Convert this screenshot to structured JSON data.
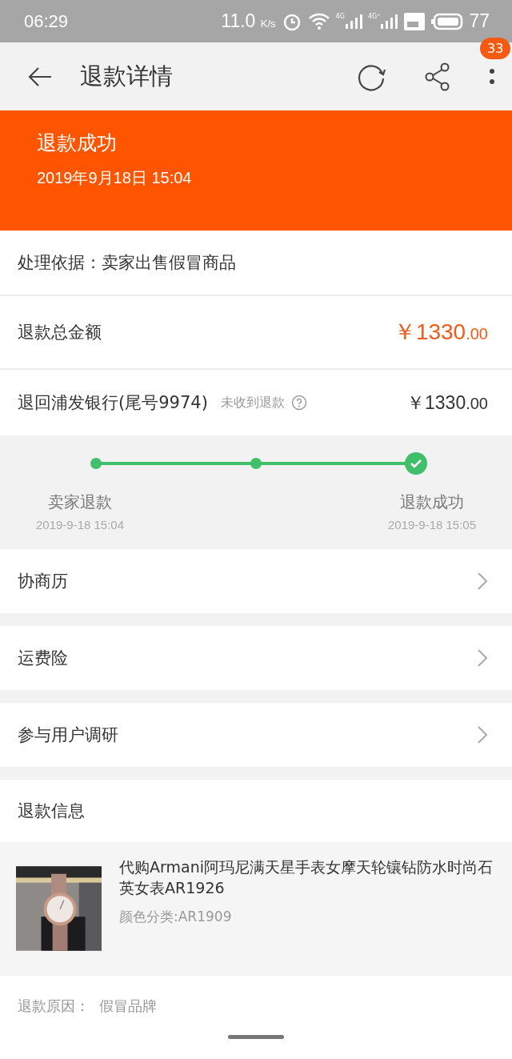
{
  "status_bar": {
    "time": "06:29",
    "speed": "11.0",
    "speed_unit": "K/s",
    "network_1": "4G",
    "network_2": "4G⁺",
    "battery": "77"
  },
  "header": {
    "title": "退款详情",
    "badge": "33"
  },
  "banner": {
    "status": "退款成功",
    "time": "2019年9月18日 15:04"
  },
  "basis": {
    "label": "处理依据：",
    "value": "卖家出售假冒商品"
  },
  "total": {
    "label": "退款总金额",
    "amount": "￥1330",
    "decimals": ".00"
  },
  "bank": {
    "label": "退回浦发银行(尾号9974)",
    "hint": "未收到退款",
    "amount": "￥1330",
    "decimals": ".00"
  },
  "steps": [
    {
      "kind": "dot",
      "label": "卖家退款",
      "time": "2019-9-18 15:04"
    },
    {
      "kind": "dot"
    },
    {
      "kind": "check",
      "label": "退款成功",
      "time": "2019-9-18 15:05"
    }
  ],
  "link_rows": [
    {
      "label": "协商历"
    },
    {
      "label": "运费险"
    },
    {
      "label": "参与用户调研"
    }
  ],
  "refund_info": {
    "title": "退款信息",
    "product": {
      "kind": "picture",
      "name": "代购Armani阿玛尼满天星手表女摩天轮镶钻防水时尚石英女表AR1926",
      "variant": "颜色分类:AR1909"
    },
    "reason_label": "退款原因：",
    "reason": "假冒品牌"
  }
}
